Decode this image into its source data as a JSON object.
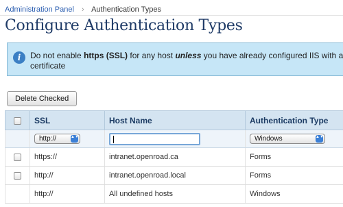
{
  "breadcrumb": {
    "parent": "Administration Panel",
    "separator": "›",
    "current": "Authentication Types"
  },
  "page_title": "Configure Authentication Types",
  "notice": {
    "icon": "info-icon",
    "icon_glyph": "i",
    "text_before": "Do not enable ",
    "text_bold": "https (SSL)",
    "text_middle": " for any host ",
    "text_emphasis": "unless",
    "text_after": " you have already configured IIS with a",
    "text_line2": "certificate"
  },
  "delete_button_label": "Delete Checked",
  "table": {
    "headers": {
      "ssl": "SSL",
      "host_name": "Host Name",
      "auth_type": "Authentication Type"
    },
    "filter": {
      "ssl_selected": "http://",
      "host_value": "",
      "auth_selected": "Windows",
      "arrows_glyph": "▲▼"
    },
    "rows": [
      {
        "ssl": "https://",
        "host": "intranet.openroad.ca",
        "auth": "Forms",
        "has_checkbox": true
      },
      {
        "ssl": "http://",
        "host": "intranet.openroad.local",
        "auth": "Forms",
        "has_checkbox": true
      },
      {
        "ssl": "http://",
        "host": "All undefined hosts",
        "auth": "Windows",
        "has_checkbox": false
      }
    ]
  },
  "colors": {
    "link": "#2a5db0",
    "title": "#1e3a66",
    "notice_bg": "#c6e6f7",
    "notice_border": "#86b9d6",
    "header_bg": "#d4e4f1",
    "filter_bg": "#eef4fa",
    "select_arrow": "#3a7fd6"
  }
}
